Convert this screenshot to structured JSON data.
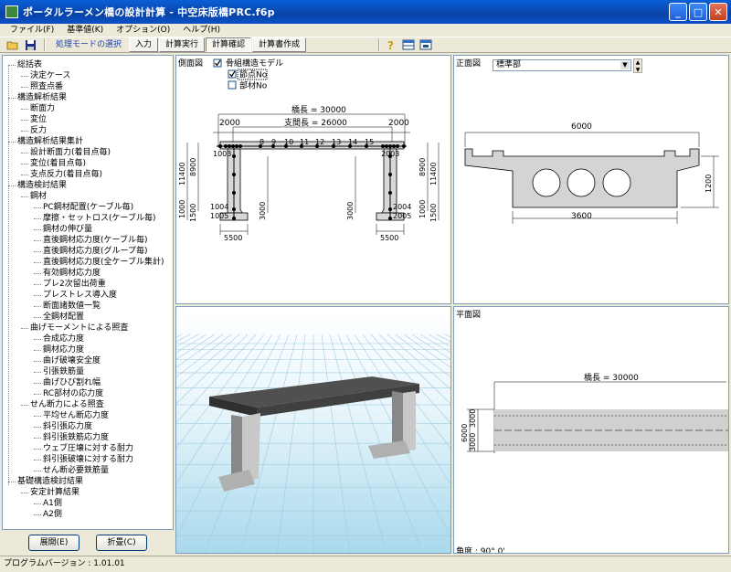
{
  "window": {
    "title": "ポータルラーメン橋の設計計算 - 中空床版橋PRC.f6p"
  },
  "menu": [
    "ファイル(F)",
    "基準値(K)",
    "オプション(O)",
    "ヘルプ(H)"
  ],
  "toolbar": {
    "mode_select": "処理モードの選択",
    "modes": [
      "入力",
      "計算実行",
      "計算確認",
      "計算書作成"
    ]
  },
  "tree": [
    {
      "label": "総括表",
      "level": 0
    },
    {
      "label": "決定ケース",
      "level": 1
    },
    {
      "label": "照査点番",
      "level": 1
    },
    {
      "label": "構造解析結果",
      "level": 0
    },
    {
      "label": "断面力",
      "level": 1
    },
    {
      "label": "変位",
      "level": 1
    },
    {
      "label": "反力",
      "level": 1
    },
    {
      "label": "構造解析結果集計",
      "level": 0
    },
    {
      "label": "設計断面力(着目点毎)",
      "level": 1
    },
    {
      "label": "変位(着目点毎)",
      "level": 1
    },
    {
      "label": "支点反力(着目点毎)",
      "level": 1
    },
    {
      "label": "構造検討結果",
      "level": 0
    },
    {
      "label": "鋼材",
      "level": 1
    },
    {
      "label": "PC鋼材配置(ケーブル毎)",
      "level": 2
    },
    {
      "label": "摩擦・セットロス(ケーブル毎)",
      "level": 2
    },
    {
      "label": "鋼材の伸び量",
      "level": 2
    },
    {
      "label": "直後鋼材応力度(ケーブル毎)",
      "level": 2
    },
    {
      "label": "直後鋼材応力度(グループ毎)",
      "level": 2
    },
    {
      "label": "直後鋼材応力度(全ケーブル集計)",
      "level": 2
    },
    {
      "label": "有効鋼材応力度",
      "level": 2
    },
    {
      "label": "プレ2次留出荷重",
      "level": 2
    },
    {
      "label": "プレストレス導入度",
      "level": 2
    },
    {
      "label": "断面諸数値一覧",
      "level": 2
    },
    {
      "label": "全鋼材配置",
      "level": 2
    },
    {
      "label": "曲げモーメントによる照査",
      "level": 1
    },
    {
      "label": "合成応力度",
      "level": 2
    },
    {
      "label": "鋼材応力度",
      "level": 2
    },
    {
      "label": "曲げ破壊安全度",
      "level": 2
    },
    {
      "label": "引張鉄筋量",
      "level": 2
    },
    {
      "label": "曲げひび割れ幅",
      "level": 2
    },
    {
      "label": "RC部材の応力度",
      "level": 2
    },
    {
      "label": "せん断力による照査",
      "level": 1
    },
    {
      "label": "平均せん断応力度",
      "level": 2
    },
    {
      "label": "斜引張応力度",
      "level": 2
    },
    {
      "label": "斜引張鉄筋応力度",
      "level": 2
    },
    {
      "label": "ウェブ圧壊に対する耐力",
      "level": 2
    },
    {
      "label": "斜引張破壊に対する耐力",
      "level": 2
    },
    {
      "label": "せん断必要鉄筋量",
      "level": 2
    },
    {
      "label": "基礎構造検討結果",
      "level": 0
    },
    {
      "label": "安定計算結果",
      "level": 1
    },
    {
      "label": "A1側",
      "level": 2
    },
    {
      "label": "A2側",
      "level": 2
    }
  ],
  "buttons": {
    "expand": "展開(E)",
    "collapse": "折畳(C)"
  },
  "side_view": {
    "label": "側面図",
    "options": [
      {
        "label": "骨組構造モデル",
        "checked": true
      },
      {
        "label": "節点No",
        "checked": true
      },
      {
        "label": "部材No",
        "checked": false
      }
    ],
    "bridge_length": "橋長 = 30000",
    "span_length": "支間長 = 26000",
    "dim_2000": "2000",
    "node_numbers": [
      "8",
      "9",
      "10",
      "11",
      "12",
      "13",
      "14",
      "15"
    ],
    "dim_8900": "8900",
    "dim_11400": "11400",
    "dim_1000": "1000",
    "dim_1500": "1500",
    "dim_3000": "3000",
    "dim_5500": "5500",
    "node_1004": "1004",
    "node_1005": "1005",
    "node_1003": "1003",
    "node_2004": "2004",
    "node_2005": "2005",
    "node_2003": "2003"
  },
  "front_view": {
    "label": "正面図",
    "select_value": "標準部",
    "dim_6000": "6000",
    "dim_1200": "1200",
    "dim_3600": "3600"
  },
  "view3d": {
    "label": "3D"
  },
  "plan_view": {
    "label": "平面図",
    "bridge_length": "橋長 = 30000",
    "dim_6000": "6000",
    "dim_3000a": "3000",
    "dim_3000b": "3000",
    "angle": "角度 : 90° 0'"
  },
  "status": {
    "version": "プログラムバージョン : 1.01.01"
  }
}
